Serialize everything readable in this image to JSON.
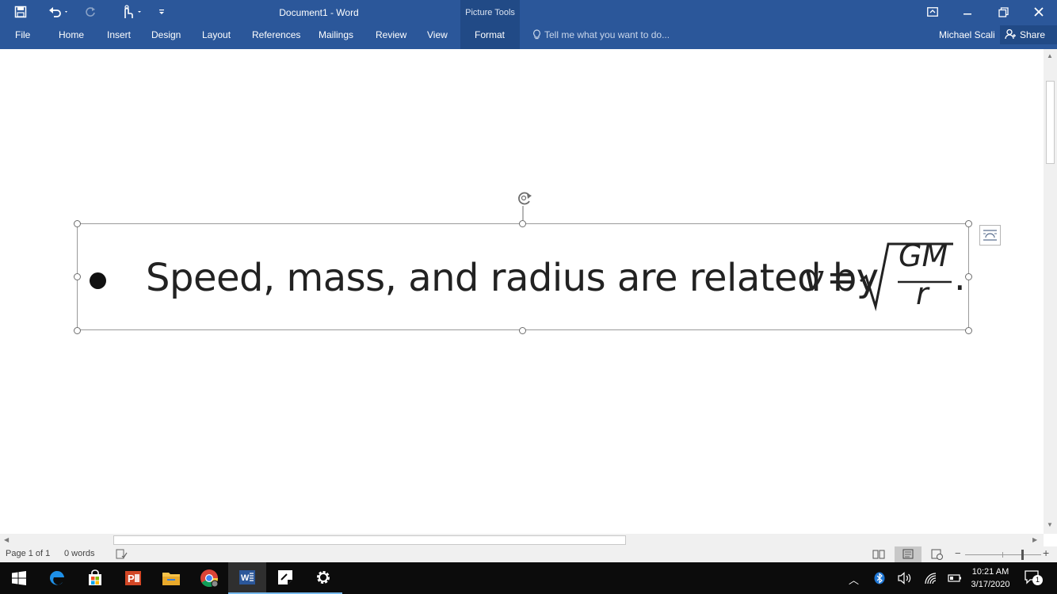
{
  "title_bar": {
    "doc_title": "Document1 - Word",
    "context_group": "Picture Tools",
    "icons": [
      "save-icon",
      "undo-icon",
      "redo-icon",
      "touch-mode-icon",
      "customize-qat-icon"
    ],
    "window_controls": [
      "ribbon-display-icon",
      "minimize-icon",
      "restore-icon",
      "close-icon"
    ]
  },
  "ribbon": {
    "tabs": [
      "File",
      "Home",
      "Insert",
      "Design",
      "Layout",
      "References",
      "Mailings",
      "Review",
      "View",
      "Format"
    ],
    "tell_me": "Tell me what you want to do...",
    "user": "Michael Scali",
    "share": "Share"
  },
  "document": {
    "sentence": "Speed, mass, and radius are related by",
    "equation": {
      "variable": "v",
      "equals": "=",
      "numerator": "GM",
      "denominator": "r",
      "end": "."
    }
  },
  "status_bar": {
    "page": "Page 1 of 1",
    "words": "0 words"
  },
  "taskbar": {
    "apps": [
      "windows-start-icon",
      "edge-icon",
      "store-icon",
      "powerpoint-icon",
      "file-explorer-icon",
      "chrome-icon",
      "word-icon",
      "sticky-notes-icon",
      "settings-icon"
    ],
    "time": "10:21 AM",
    "date": "3/17/2020",
    "notifications": "1"
  },
  "colors": {
    "ribbon": "#2b579a",
    "ribbon_dark": "#214a86",
    "taskbar": "#0c0c0c"
  }
}
